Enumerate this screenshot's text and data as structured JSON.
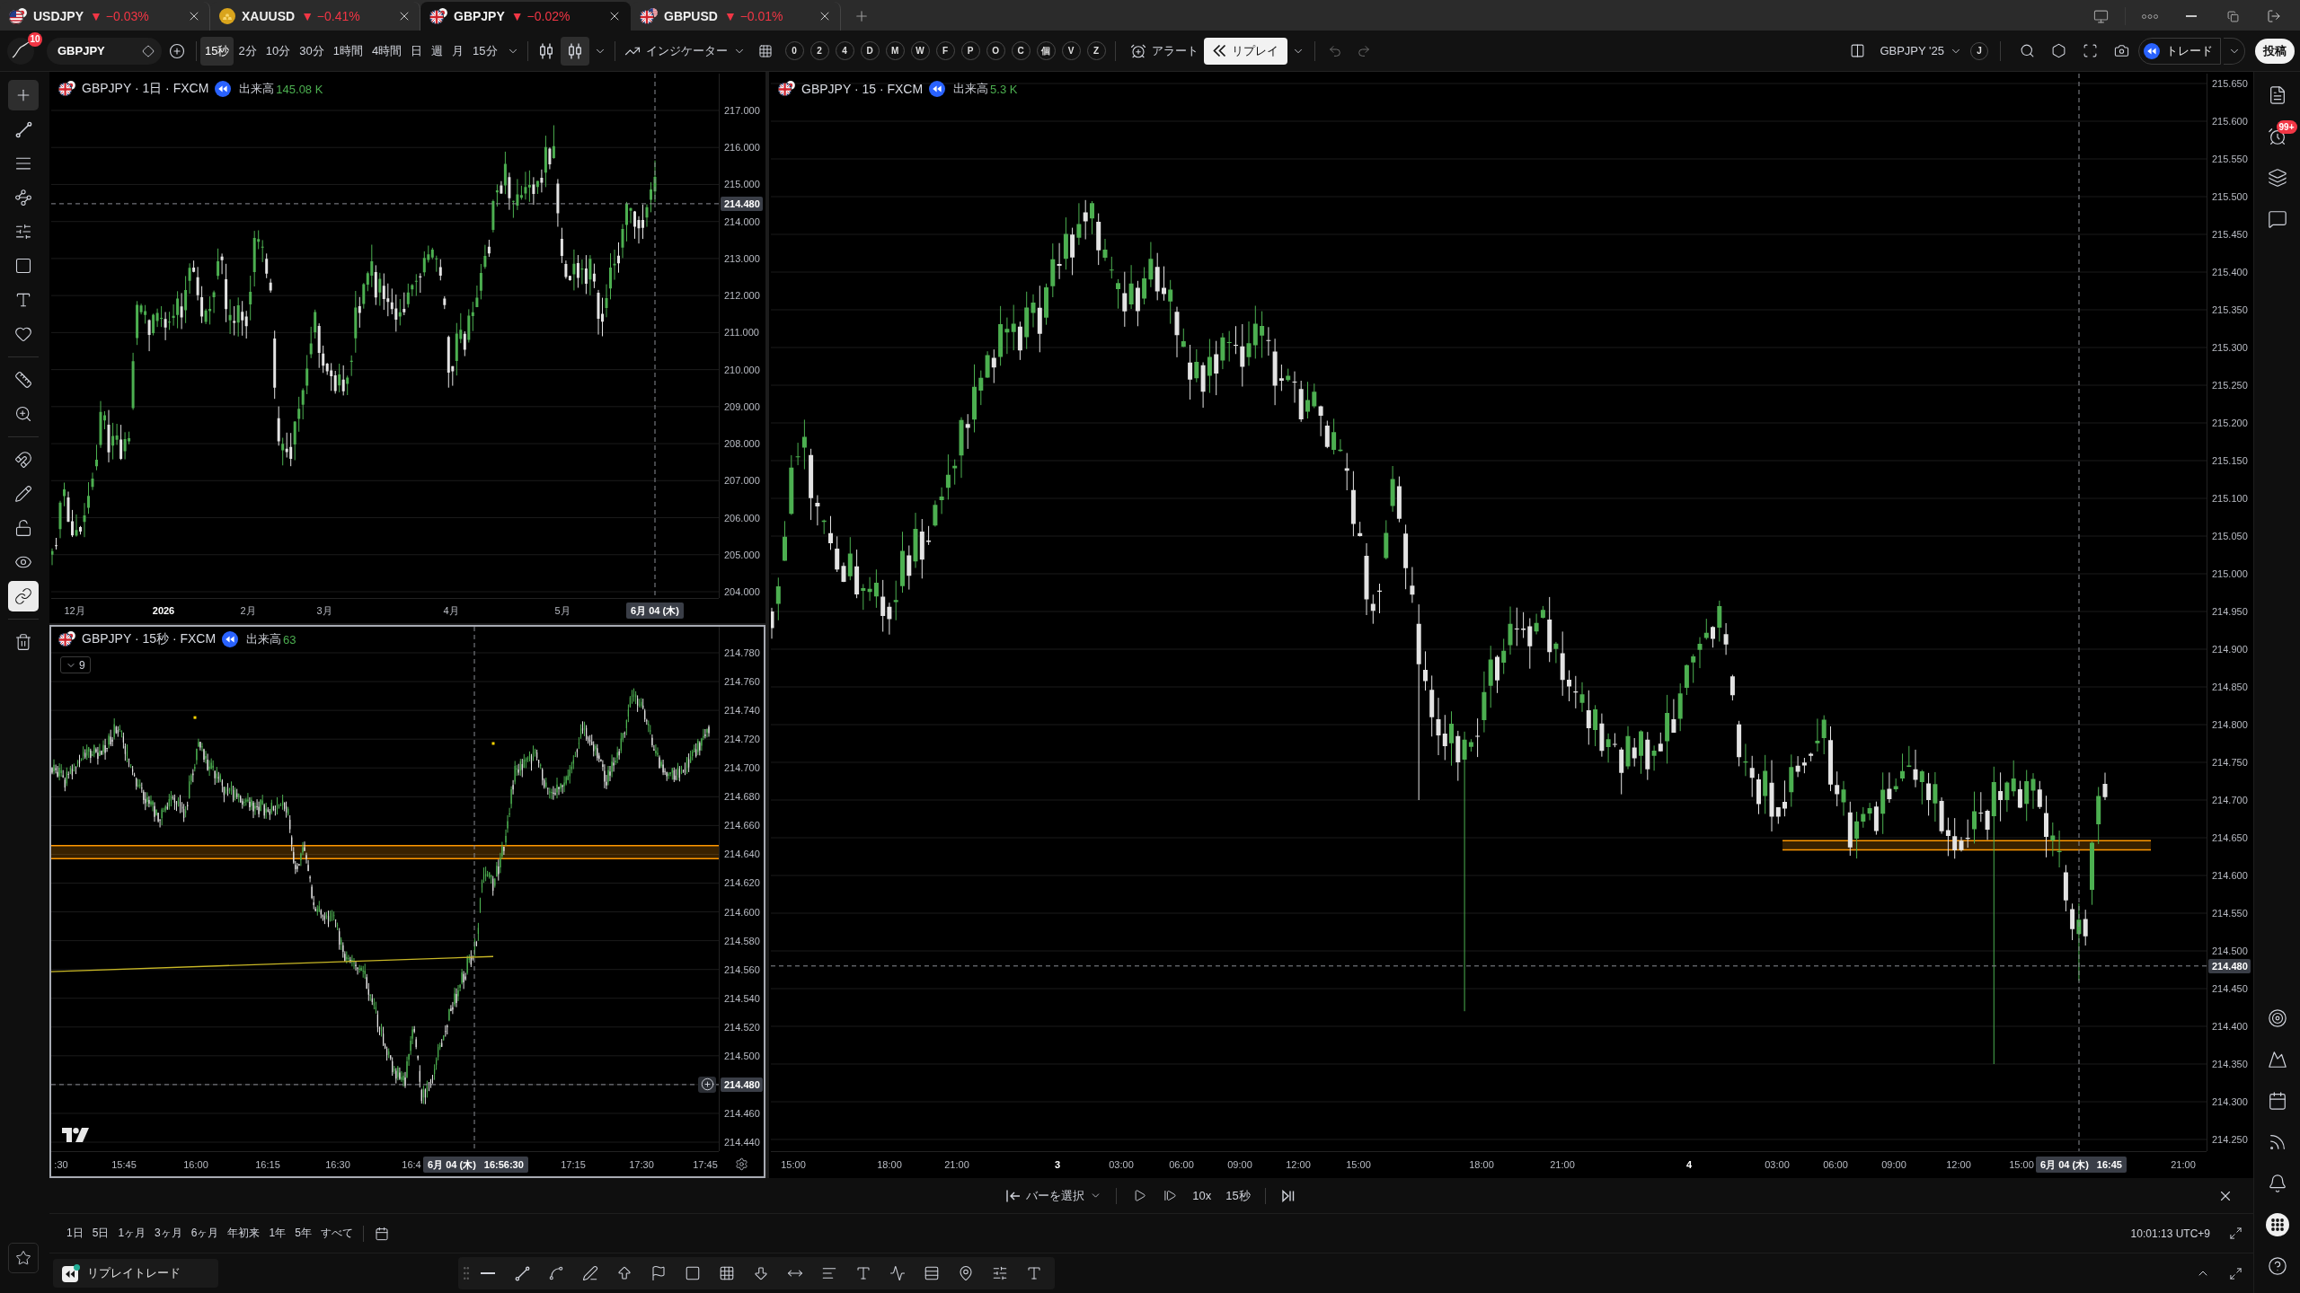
{
  "tabs": [
    {
      "symbol": "USDJPY",
      "change": "▼ −0.03%",
      "selected": false
    },
    {
      "symbol": "XAUUSD",
      "change": "▼ −0.41%",
      "selected": false
    },
    {
      "symbol": "GBPJPY",
      "change": "▼ −0.02%",
      "selected": true
    },
    {
      "symbol": "GBPUSD",
      "change": "▼ −0.01%",
      "selected": false
    }
  ],
  "toolbar": {
    "account_badge": "10",
    "symbol": "GBPJPY",
    "intervals": [
      {
        "label": "15秒",
        "selected": true
      },
      {
        "label": "2分",
        "selected": false
      },
      {
        "label": "10分",
        "selected": false
      },
      {
        "label": "30分",
        "selected": false
      },
      {
        "label": "1時間",
        "selected": false
      },
      {
        "label": "4時間",
        "selected": false
      },
      {
        "label": "日",
        "selected": false
      },
      {
        "label": "週",
        "selected": false
      },
      {
        "label": "月",
        "selected": false
      },
      {
        "label": "15分",
        "selected": false
      }
    ],
    "chart_styles": [
      {
        "selected": false
      },
      {
        "selected": true
      }
    ],
    "indicators": "インジケーター",
    "quick_keys": [
      "0",
      "2",
      "4",
      "D",
      "M",
      "W",
      "F",
      "P",
      "O",
      "C",
      "個",
      "V",
      "Z"
    ],
    "alert": "アラート",
    "replay": {
      "label": "リプレイ",
      "active": true
    },
    "layout_name": "GBPJPY '25",
    "layout_key": "J",
    "trade": "トレード",
    "publish": "投稿"
  },
  "drawing_toolbar": [
    {
      "kind": "tools",
      "items": [
        {
          "kind": "crosshair",
          "selected": true
        },
        {
          "kind": "trendline",
          "selected": false
        },
        {
          "kind": "lines",
          "selected": false
        },
        {
          "kind": "pattern",
          "selected": false
        },
        {
          "kind": "projection",
          "selected": false
        },
        {
          "kind": "rectangle",
          "selected": false
        },
        {
          "kind": "text",
          "selected": false
        },
        {
          "kind": "favorite",
          "selected": false
        }
      ]
    },
    {
      "kind": "tools",
      "items": [
        {
          "kind": "ruler",
          "selected": false
        },
        {
          "kind": "zoom",
          "selected": false
        }
      ]
    },
    {
      "kind": "toggles",
      "items": [
        {
          "kind": "magnet",
          "selected": false
        },
        {
          "kind": "drawlock",
          "selected": false
        },
        {
          "kind": "lock",
          "selected": false
        },
        {
          "kind": "visibility",
          "selected": false
        },
        {
          "kind": "sync",
          "selected": true
        }
      ]
    },
    {
      "kind": "tools",
      "items": [
        {
          "kind": "trash",
          "selected": false
        }
      ]
    }
  ],
  "charts": [
    {
      "title": "GBPJPY · 1日 · FXCM",
      "volume_label": "出来高",
      "volume": "145.08 K",
      "selected": false,
      "price_axis": [
        "217.000",
        "216.000",
        "215.000",
        "214.000",
        "213.000",
        "212.000",
        "211.000",
        "210.000",
        "209.000",
        "208.000",
        "207.000",
        "206.000",
        "205.000",
        "204.000"
      ],
      "last_price": "214.480",
      "time_axis": [
        {
          "label": "12月",
          "kind": "month"
        },
        {
          "label": "2026",
          "kind": "year"
        },
        {
          "label": "2月",
          "kind": "month"
        },
        {
          "label": "3月",
          "kind": "month"
        },
        {
          "label": "4月",
          "kind": "month"
        },
        {
          "label": "5月",
          "kind": "month"
        }
      ],
      "cursor_time": {
        "date": "6月 04 (木)"
      }
    },
    {
      "title": "GBPJPY · 15秒 · FXCM",
      "volume_label": "出来高",
      "volume": "63",
      "selected": true,
      "legend_count": "9",
      "price_axis": [
        "214.780",
        "214.760",
        "214.740",
        "214.720",
        "214.700",
        "214.680",
        "214.660",
        "214.640",
        "214.620",
        "214.600",
        "214.580",
        "214.560",
        "214.540",
        "214.520",
        "214.500",
        "214.460",
        "214.440"
      ],
      "last_price": "214.480",
      "time_axis": [
        {
          "label": ":30",
          "kind": "time"
        },
        {
          "label": "15:45",
          "kind": "time"
        },
        {
          "label": "16:00",
          "kind": "time"
        },
        {
          "label": "16:15",
          "kind": "time"
        },
        {
          "label": "16:30",
          "kind": "time"
        },
        {
          "label": "16:4",
          "kind": "time"
        },
        {
          "label": "17:15",
          "kind": "time"
        },
        {
          "label": "17:30",
          "kind": "time"
        },
        {
          "label": "17:45",
          "kind": "time"
        }
      ],
      "cursor_time": {
        "date": "6月 04 (木)",
        "time": "16:56:30"
      }
    },
    {
      "title": "GBPJPY · 15 · FXCM",
      "volume_label": "出来高",
      "volume": "5.3 K",
      "selected": false,
      "price_axis": [
        "215.650",
        "215.600",
        "215.550",
        "215.500",
        "215.450",
        "215.400",
        "215.350",
        "215.300",
        "215.250",
        "215.200",
        "215.150",
        "215.100",
        "215.050",
        "215.000",
        "214.950",
        "214.900",
        "214.850",
        "214.800",
        "214.750",
        "214.700",
        "214.650",
        "214.600",
        "214.550",
        "214.500",
        "214.450",
        "214.400",
        "214.350",
        "214.300",
        "214.250"
      ],
      "last_price": "214.480",
      "time_axis": [
        {
          "label": "15:00",
          "kind": "time"
        },
        {
          "label": "18:00",
          "kind": "time"
        },
        {
          "label": "21:00",
          "kind": "time"
        },
        {
          "label": "3",
          "kind": "day"
        },
        {
          "label": "03:00",
          "kind": "time"
        },
        {
          "label": "06:00",
          "kind": "time"
        },
        {
          "label": "09:00",
          "kind": "time"
        },
        {
          "label": "12:00",
          "kind": "time"
        },
        {
          "label": "15:00",
          "kind": "time"
        },
        {
          "label": "18:00",
          "kind": "time"
        },
        {
          "label": "21:00",
          "kind": "time"
        },
        {
          "label": "4",
          "kind": "day"
        },
        {
          "label": "03:00",
          "kind": "time"
        },
        {
          "label": "06:00",
          "kind": "time"
        },
        {
          "label": "09:00",
          "kind": "time"
        },
        {
          "label": "12:00",
          "kind": "time"
        },
        {
          "label": "15:00",
          "kind": "time"
        },
        {
          "label": "21:00",
          "kind": "time"
        }
      ],
      "cursor_time": {
        "date": "6月 04 (木)",
        "time": "16:45"
      }
    }
  ],
  "replay_bar": {
    "select_bar": "バーを選択",
    "speed": "10x",
    "interval": "15秒"
  },
  "range_bar": {
    "ranges": [
      "1日",
      "5日",
      "1ヶ月",
      "3ヶ月",
      "6ヶ月",
      "年初来",
      "1年",
      "5年",
      "すべて"
    ],
    "clock": "10:01:13 UTC+9"
  },
  "bottom_panel": {
    "tab": "リプレイトレード"
  },
  "right_sidebar": {
    "alerts_badge": "99+"
  }
}
